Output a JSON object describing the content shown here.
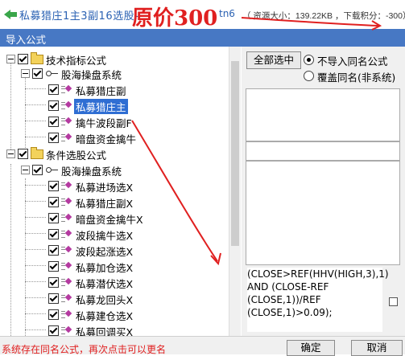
{
  "header": {
    "title": "私募猎庄1主3副16选股-",
    "ext": "tn6",
    "info": "（ 资源大小：139.22KB ，下载积分：-300）",
    "annotation": "原价300"
  },
  "dialog": {
    "title": "导入公式"
  },
  "tree": {
    "groups": [
      {
        "label": "技术指标公式",
        "system": "股海操盘系统",
        "items": [
          {
            "label": "私募猎庄副"
          },
          {
            "label": "私募猎庄主"
          },
          {
            "label": "擒牛波段副F"
          },
          {
            "label": "暗盘资金擒牛"
          }
        ]
      },
      {
        "label": "条件选股公式",
        "system": "股海操盘系统",
        "items": [
          {
            "label": "私募进场选X"
          },
          {
            "label": "私募猎庄副X"
          },
          {
            "label": "暗盘资金擒牛X"
          },
          {
            "label": "波段擒牛选X"
          },
          {
            "label": "波段起涨选X"
          },
          {
            "label": "私募加仓选X"
          },
          {
            "label": "私募潜伏选X"
          },
          {
            "label": "私募龙回头X"
          },
          {
            "label": "私募建仓选X"
          },
          {
            "label": "私募回调买X"
          }
        ]
      }
    ]
  },
  "right": {
    "select_all": "全部选中",
    "options": [
      {
        "label": "不导入同名公式",
        "selected": true
      },
      {
        "label": "覆盖同名(非系统)",
        "selected": false
      }
    ],
    "formula_text": "(CLOSE>REF(HHV(HIGH,3),1) AND (CLOSE-REF (CLOSE,1))/REF (CLOSE,1)>0.09);"
  },
  "footer": {
    "status": "系统存在同名公式，再次点击可以更名",
    "ok": "确定",
    "cancel": "取消"
  },
  "colors": {
    "titlebar": "#4778c4",
    "annotation": "#e02020",
    "selection": "#2f6ed3"
  }
}
